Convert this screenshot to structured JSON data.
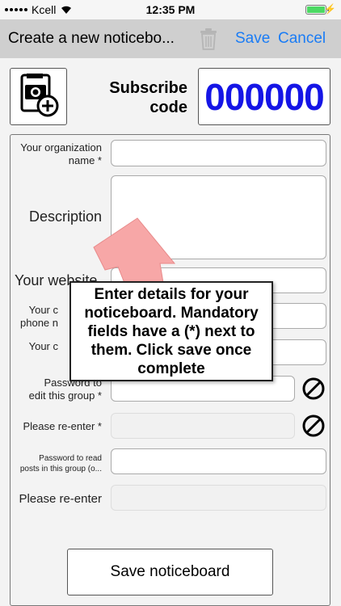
{
  "status_bar": {
    "carrier": "Kcell",
    "time": "12:35 PM"
  },
  "nav": {
    "title": "Create a new noticebo...",
    "save_label": "Save",
    "cancel_label": "Cancel",
    "trash_icon": "trash-icon",
    "accent_color": "#1a7cf5"
  },
  "header": {
    "photo_icon": "add-photo-icon",
    "subscribe_label_line1": "Subscribe",
    "subscribe_label_line2": "code",
    "subscribe_code": "000000",
    "code_color": "#1515e6"
  },
  "form": {
    "org_name_line1": "Your organization",
    "org_name_line2": "name *",
    "description_label": "Description",
    "website_label": "Your website",
    "phone_line1": "Your c",
    "phone_line2": "phone n",
    "contact_label": "Your c",
    "edit_pw_line1": "Password to",
    "edit_pw_line2": "edit this group *",
    "reenter_label": "Please re-enter *",
    "read_pw_line1": "Password to read",
    "read_pw_line2": "posts in this group (o...",
    "reenter_optional_label": "Please re-enter",
    "toggle_icon": "ban-icon"
  },
  "save_noticeboard_label": "Save noticeboard",
  "tooltip": {
    "text": "Enter details for your noticeboard. Mandatory fields have a (*) next to them. Click save once complete",
    "arrow_color": "#f7a7a7"
  }
}
